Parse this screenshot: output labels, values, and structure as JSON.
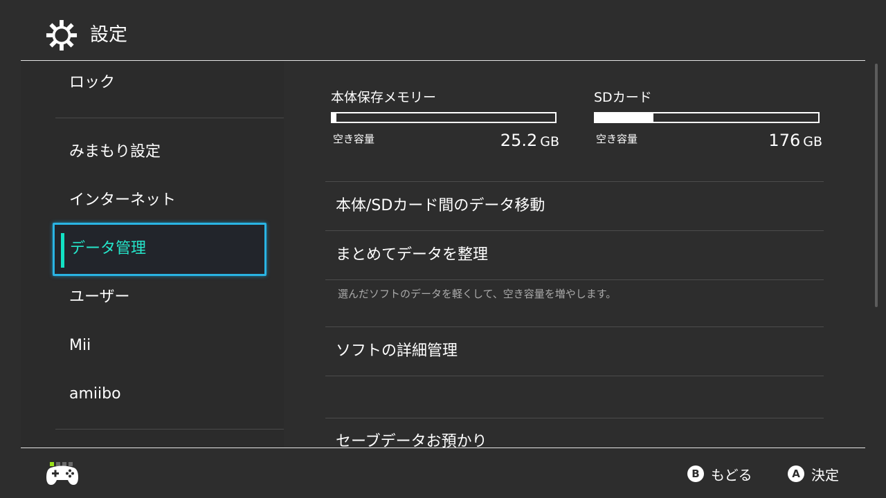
{
  "header": {
    "title": "設定",
    "icon": "gear-icon"
  },
  "sidebar": {
    "items": [
      {
        "label": "ロック"
      },
      {
        "label": "みまもり設定"
      },
      {
        "label": "インターネット"
      },
      {
        "label": "データ管理",
        "selected": true
      },
      {
        "label": "ユーザー"
      },
      {
        "label": "Mii"
      },
      {
        "label": "amiibo"
      }
    ]
  },
  "storage": {
    "internal": {
      "title": "本体保存メモリー",
      "free_label": "空き容量",
      "free_value": "25.2",
      "unit": "GB",
      "used_fraction": 0.02
    },
    "sd": {
      "title": "SDカード",
      "free_label": "空き容量",
      "free_value": "176",
      "unit": "GB",
      "used_fraction": 0.26
    }
  },
  "menu": {
    "items": [
      {
        "label": "本体/SDカード間のデータ移動"
      },
      {
        "label": "まとめてデータを整理",
        "description": "選んだソフトのデータを軽くして、空き容量を増やします。"
      },
      {
        "label": "ソフトの詳細管理"
      },
      {
        "label": "セーブデータお預かり"
      }
    ]
  },
  "footer": {
    "back": {
      "button": "B",
      "label": "もどる"
    },
    "confirm": {
      "button": "A",
      "label": "決定"
    }
  },
  "colors": {
    "accent": "#13e2c4",
    "selection_border": "#2ab4e4",
    "background": "#2d2d2d",
    "player_indicator": "#9ae21a"
  }
}
